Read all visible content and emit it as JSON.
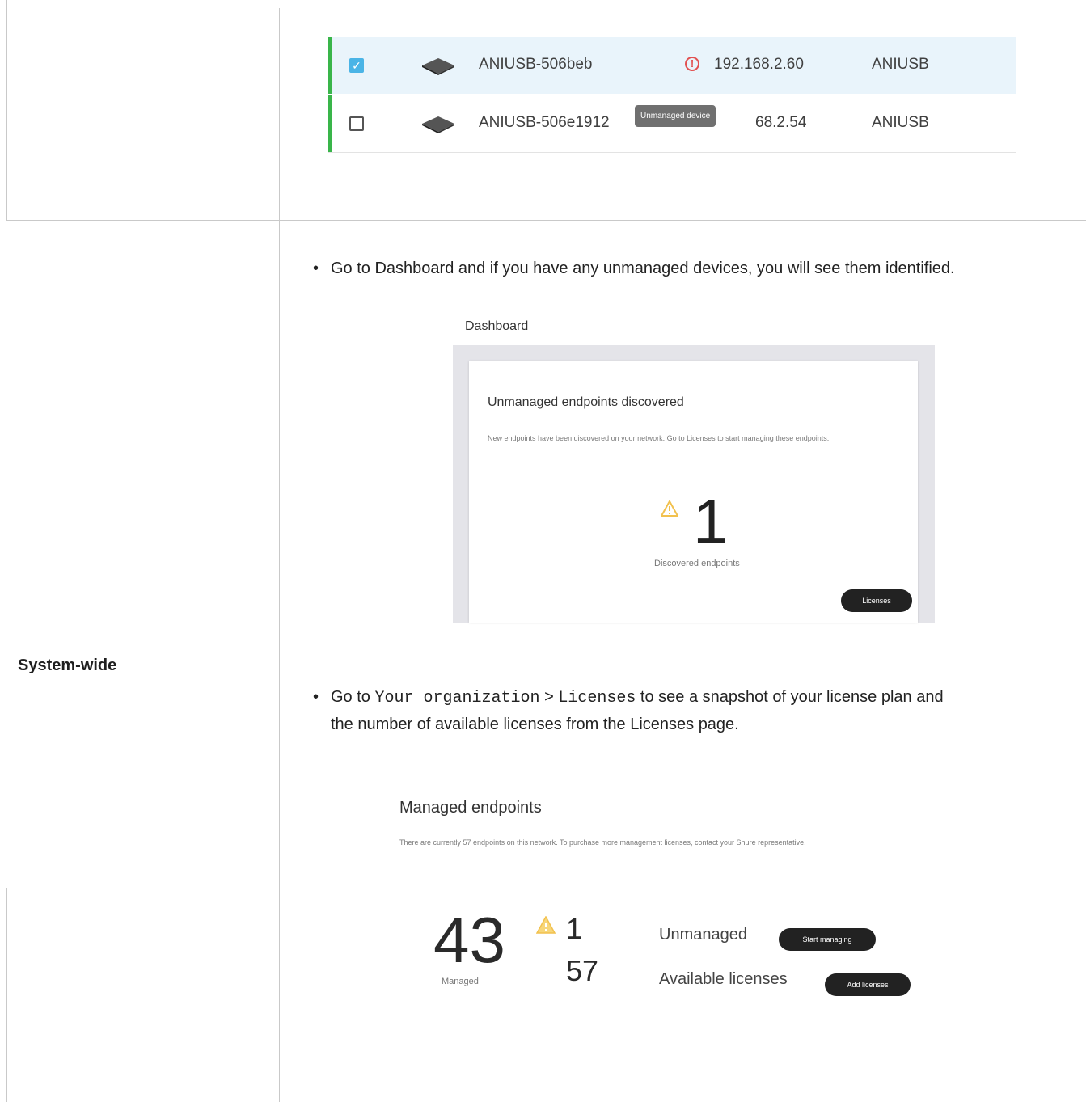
{
  "device_table": {
    "rows": [
      {
        "checked": true,
        "name": "ANIUSB-506beb",
        "ip": "192.168.2.60",
        "model": "ANIUSB",
        "alert": true
      },
      {
        "checked": false,
        "name": "ANIUSB-506e1912",
        "ip": "68.2.54",
        "model": "ANIUSB",
        "alert": false
      }
    ],
    "tooltip": "Unmanaged device"
  },
  "row_label": "System-wide",
  "bullet1": {
    "text": "Go to Dashboard and if you have any unmanaged devices, you will see them identified."
  },
  "dashboard": {
    "title": "Dashboard",
    "card_title": "Unmanaged endpoints discovered",
    "card_text": "New endpoints have been discovered on your network. Go to Licenses to start managing these endpoints.",
    "count": "1",
    "count_label": "Discovered endpoints",
    "button": "Licenses"
  },
  "bullet2": {
    "prefix": "Go to ",
    "code1": "Your organization",
    "sep": " > ",
    "code2": "Licenses",
    "suffix": " to see a snapshot of your license plan and",
    "line2": "the number of available licenses from the Licenses page."
  },
  "licenses": {
    "title": "Managed endpoints",
    "text": "There are currently 57 endpoints on this network. To purchase more management licenses, contact your Shure representative.",
    "managed_count": "43",
    "managed_label": "Managed",
    "unmanaged_count": "1",
    "unmanaged_label": "Unmanaged",
    "start_button": "Start managing",
    "available_count": "57",
    "available_label": "Available licenses",
    "add_button": "Add licenses"
  },
  "colors": {
    "green_bar": "#39b54a",
    "checkbox_blue": "#4ab4e6",
    "alert_red": "#e25050",
    "warning_yellow": "#f2c14e"
  }
}
